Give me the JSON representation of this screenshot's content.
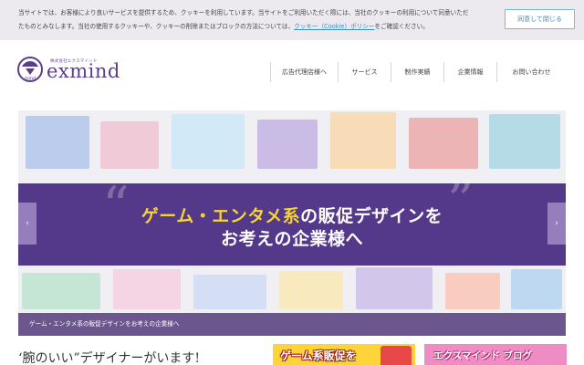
{
  "cookie_banner": {
    "line1": "当サイトでは、お客様により良いサービスを提供するため、クッキーを利用しています。当サイトをご利用いただく際には、当社のクッキーの利用について同意いただ",
    "line2_pre": "たものとみなします。当社の使用するクッキーや、クッキーの削除またはブロックの方法については、",
    "line2_link": "クッキー（Cookie）ポリシー",
    "line2_post": "をご確認ください。",
    "agree_button": "同意して閉じる"
  },
  "header": {
    "logo_small": "株式会社エクスマインド",
    "logo_word": "exmind",
    "logo_mark_label": "mind",
    "nav": [
      {
        "label": "広告代理店様へ"
      },
      {
        "label": "サービス"
      },
      {
        "label": "制作実績"
      },
      {
        "label": "企業情報"
      },
      {
        "label": "お問い合わせ"
      }
    ]
  },
  "hero": {
    "line1_highlight": "ゲーム・エンタメ系",
    "line1_rest": "の販促デザインを",
    "line2": "お考えの企業様へ",
    "caption": "ゲーム・エンタメ系の販促デザインをお考えの企業様へ",
    "prev_arrow": "‹",
    "next_arrow": "›",
    "quote_open": "“",
    "quote_close": "”"
  },
  "bottom": {
    "tagline": "‘腕のいい”デザイナーがいます!",
    "banner1_text": "ゲーム系販促を",
    "banner2_text": "エクスマインド ブログ"
  },
  "colors": {
    "brand_purple": "#5b3f8c",
    "band_purple": "#482a80",
    "highlight_yellow": "#f5d334",
    "link_blue": "#3d8bc8"
  }
}
